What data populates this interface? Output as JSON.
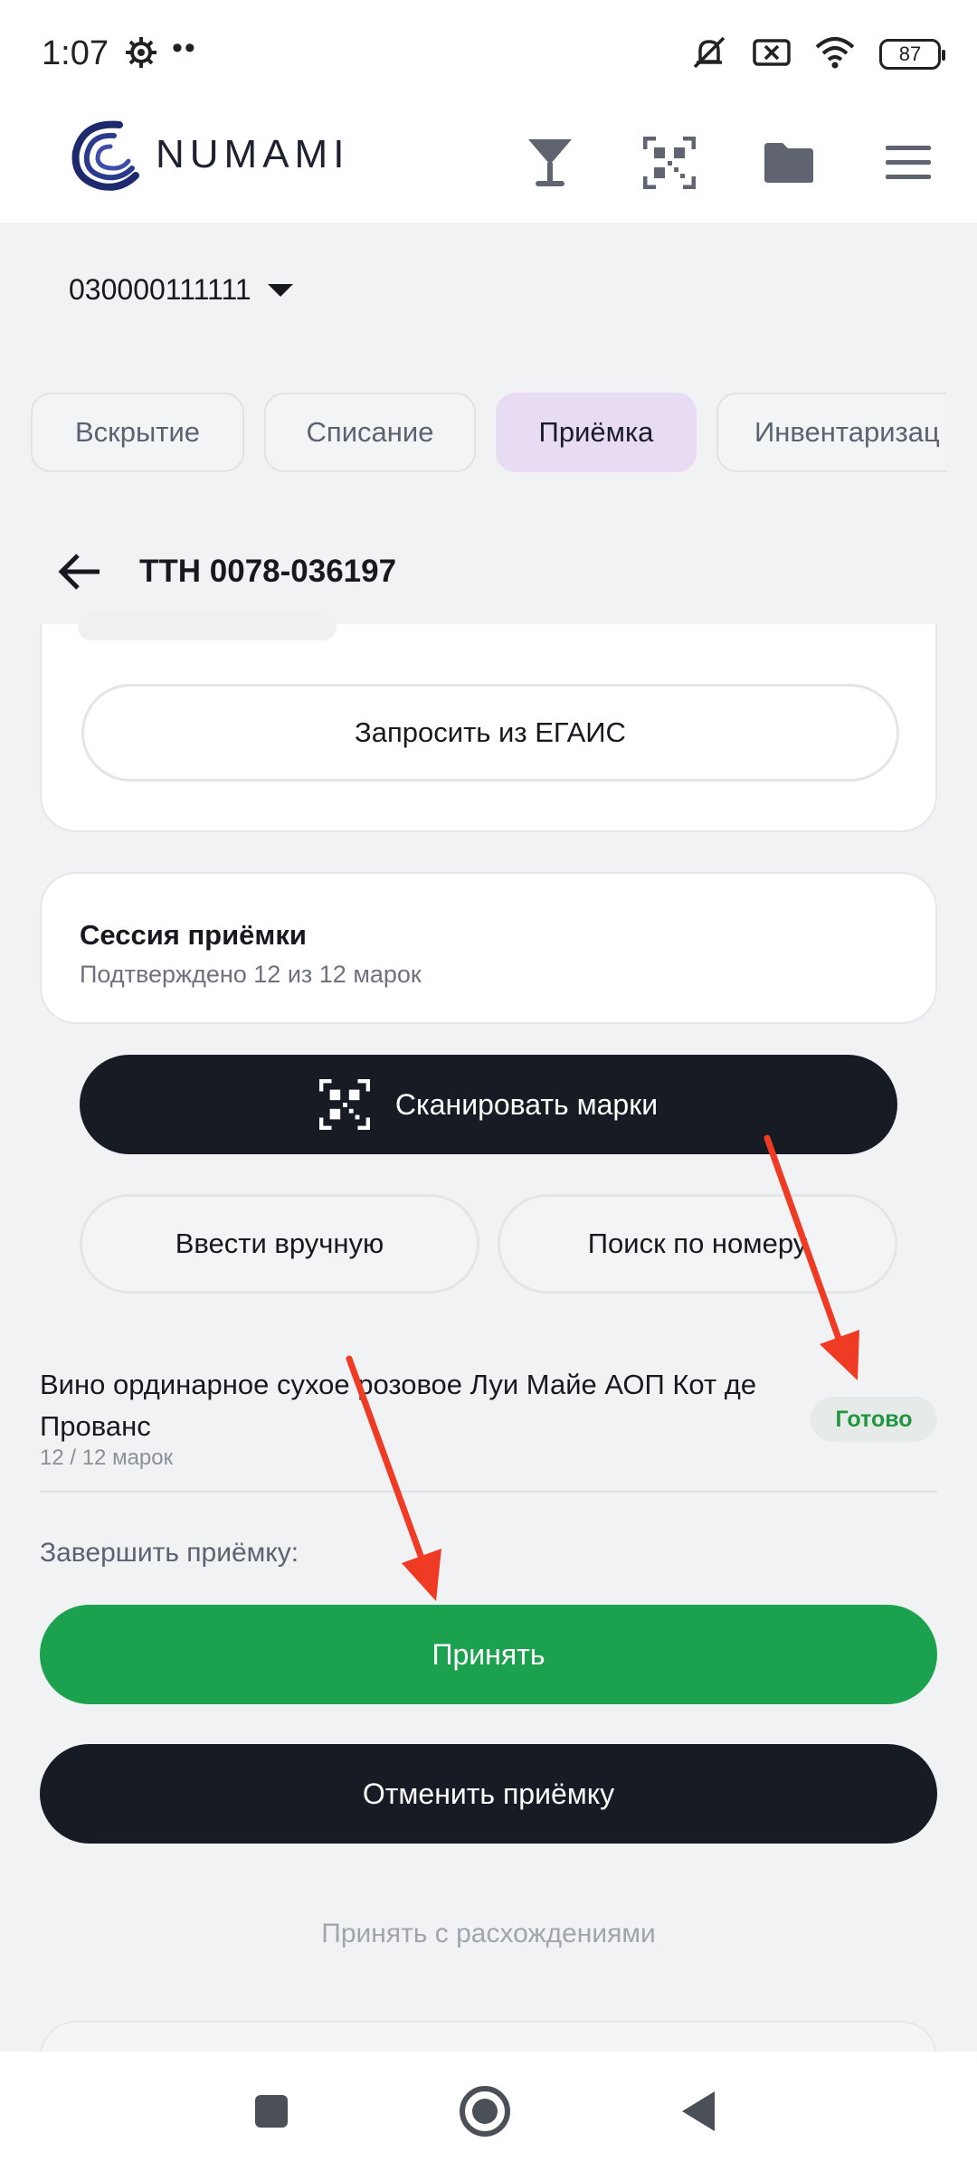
{
  "status": {
    "time": "1:07",
    "dots": "••",
    "battery": "87",
    "icons": [
      "settings-icon",
      "mute-icon",
      "sim-off-icon",
      "wifi-icon",
      "battery-icon"
    ]
  },
  "header": {
    "logo_text": "NUMAMI",
    "icons": [
      "wine-glass-icon",
      "qr-code-icon",
      "folder-icon",
      "menu-icon"
    ]
  },
  "store": {
    "id": "030000111111"
  },
  "tabs": [
    {
      "label": "Вскрытие",
      "active": false
    },
    {
      "label": "Списание",
      "active": false
    },
    {
      "label": "Приёмка",
      "active": true
    },
    {
      "label": "Инвентаризац",
      "active": false
    }
  ],
  "page": {
    "title": "ТТН 0078-036197"
  },
  "request_button": "Запросить из ЕГАИС",
  "session": {
    "title": "Сессия приёмки",
    "subtitle": "Подтверждено 12 из 12 марок"
  },
  "scan_button": "Сканировать марки",
  "manual_button": "Ввести вручную",
  "search_button": "Поиск по номеру",
  "item": {
    "name": "Вино ординарное сухое розовое Луи Майе АОП Кот де Прованс",
    "count": "12 / 12 марок",
    "status": "Готово"
  },
  "finish": {
    "label": "Завершить приёмку:",
    "accept": "Принять",
    "cancel": "Отменить приёмку",
    "accept_with_diff": "Принять с расхождениями"
  },
  "colors": {
    "accent_green": "#1ca24f",
    "dark": "#171b24",
    "tab_active": "#e7dcf4",
    "arrow": "#ef3b24"
  }
}
